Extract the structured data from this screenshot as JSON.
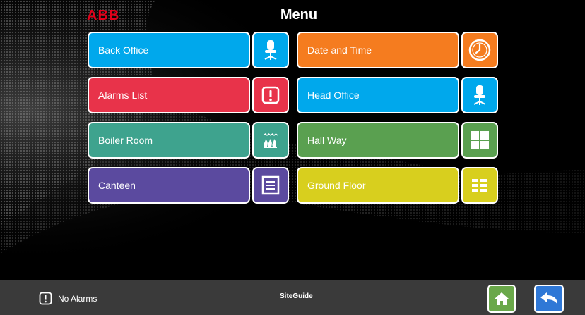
{
  "header": {
    "logo_text": "ABB",
    "title": "Menu"
  },
  "menu": [
    {
      "label": "Back Office",
      "color": "#00a8ec",
      "icon": "office-chair-icon"
    },
    {
      "label": "Date and Time",
      "color": "#f57c1f",
      "icon": "clock-icon"
    },
    {
      "label": "Alarms List",
      "color": "#e8334a",
      "icon": "alarm-exclamation-icon"
    },
    {
      "label": "Head Office",
      "color": "#00a8ec",
      "icon": "office-chair-icon"
    },
    {
      "label": "Boiler Room",
      "color": "#3ea38e",
      "icon": "flame-heating-icon"
    },
    {
      "label": "Hall Way",
      "color": "#5aa050",
      "icon": "grid-4-icon"
    },
    {
      "label": "Canteen",
      "color": "#5b4a9f",
      "icon": "list-document-icon"
    },
    {
      "label": "Ground Floor",
      "color": "#d8cf1e",
      "icon": "list-columns-icon"
    }
  ],
  "status_bar": {
    "alarm_text": "No Alarms",
    "site_text": "SiteGuide",
    "home_color": "#6aa84a",
    "back_color": "#2f78d6"
  }
}
